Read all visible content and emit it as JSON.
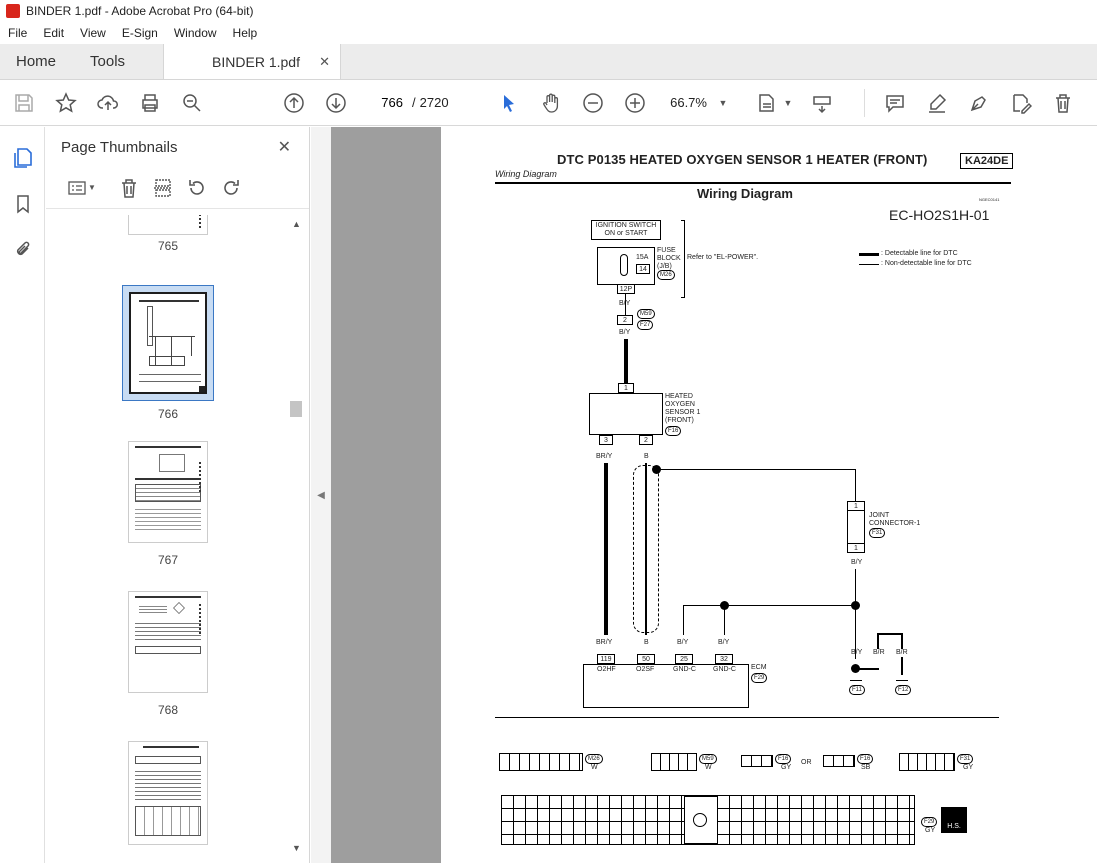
{
  "window": {
    "title": "BINDER 1.pdf - Adobe Acrobat Pro (64-bit)"
  },
  "menu": [
    "File",
    "Edit",
    "View",
    "E-Sign",
    "Window",
    "Help"
  ],
  "tabs": {
    "home": "Home",
    "tools": "Tools",
    "doc": "BINDER 1.pdf",
    "doc_close": "✕"
  },
  "toolbar": {
    "page_current": "766",
    "page_sep": "/",
    "page_total": "2720",
    "zoom": "66.7%"
  },
  "thumbnails": {
    "title": "Page Thumbnails",
    "close": "✕",
    "pages": [
      "765",
      "766",
      "767",
      "768"
    ],
    "selected": "766"
  },
  "page": {
    "header": "DTC P0135 HEATED OXYGEN SENSOR 1 HEATER (FRONT)",
    "engine": "KA24DE",
    "subheader": "Wiring Diagram",
    "diagram_title": "Wiring Diagram",
    "small_code": "NGEC0141",
    "diagram_code": "EC-HO2S1H-01",
    "ignition": "IGNITION SWITCH\nON or START",
    "fuse_label": "FUSE\nBLOCK\n(J/B)",
    "fuse_amp": "15A",
    "fuse_pin": "14",
    "refer": "Refer to \"EL-POWER\".",
    "legend_detectable": ": Detectable line for DTC",
    "legend_nondetectable": ": Non-detectable line for DTC",
    "sensor_label": "HEATED\nOXYGEN\nSENSOR 1\n(FRONT)",
    "joint_label": "JOINT\nCONNECTOR-1",
    "ecm_label": "ECM",
    "conn_m26": "M26",
    "conn_m59": "M59",
    "conn_f27": "F27",
    "conn_f16": "F16",
    "conn_f31": "F31",
    "conn_f29": "F29",
    "conn_f11": "F11",
    "conn_f12": "F12",
    "pin_12p": "12P",
    "pin_2": "2",
    "pin_1": "1",
    "pin_3": "3",
    "wire_by": "B/Y",
    "wire_bry": "BR/Y",
    "wire_b": "B",
    "wire_br": "B/R",
    "ecm_pins": [
      "119",
      "50",
      "25",
      "32"
    ],
    "ecm_names": [
      "O2HF",
      "O2SF",
      "GND-C",
      "GND-C"
    ],
    "color_w": "W",
    "color_gy": "GY",
    "color_sb": "SB",
    "or_label": "OR",
    "hs_label": "H.S."
  }
}
